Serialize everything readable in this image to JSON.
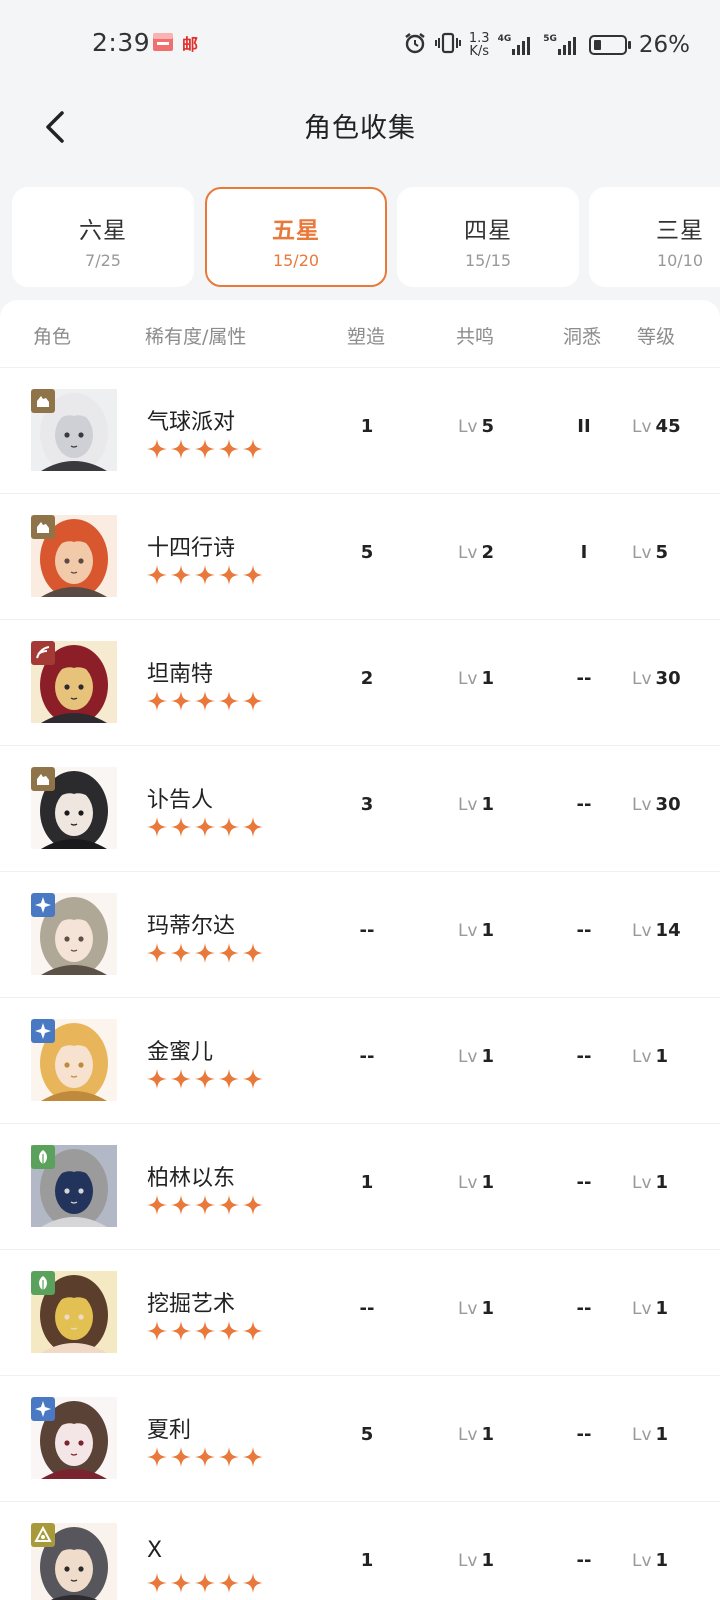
{
  "status_bar": {
    "time": "2:39",
    "app_icon_2": "邮",
    "net_speed_value": "1.3",
    "net_speed_unit": "K/s",
    "net_4g": "4G",
    "net_5g": "5G",
    "battery_percent": "26%",
    "battery_level": 0.26
  },
  "header": {
    "title": "角色收集"
  },
  "tabs": [
    {
      "label": "六星",
      "count": "7/25",
      "active": false
    },
    {
      "label": "五星",
      "count": "15/20",
      "active": true
    },
    {
      "label": "四星",
      "count": "15/15",
      "active": false
    },
    {
      "label": "三星",
      "count": "10/10",
      "active": false
    }
  ],
  "columns": {
    "role": "角色",
    "rarity": "稀有度/属性",
    "mold": "塑造",
    "resonance": "共鸣",
    "insight": "洞悉",
    "level": "等级"
  },
  "level_prefix": "Lv",
  "colors": {
    "accent": "#e8793a",
    "element_beast": "#8e7448",
    "element_spirit": "#4a79c4",
    "element_plant": "#5aa15b",
    "element_star": "#a89a3a",
    "element_mineral": "#a33a35"
  },
  "characters": [
    {
      "name": "气球派对",
      "element": "beast",
      "element_icon": "beast-element-icon",
      "rarity": 5,
      "mold": "1",
      "resonance": "5",
      "insight": "II",
      "level": "45",
      "palette": [
        "#e9e9ec",
        "#cfd0d6",
        "#3a3a3e"
      ]
    },
    {
      "name": "十四行诗",
      "element": "beast",
      "element_icon": "beast-element-icon",
      "rarity": 5,
      "mold": "5",
      "resonance": "2",
      "insight": "I",
      "level": "5",
      "palette": [
        "#d9572e",
        "#f2c9a9",
        "#5a4a44"
      ]
    },
    {
      "name": "坦南特",
      "element": "mineral",
      "element_icon": "mineral-element-icon",
      "rarity": 5,
      "mold": "2",
      "resonance": "1",
      "insight": "--",
      "level": "30",
      "palette": [
        "#8c1e28",
        "#e6c27a",
        "#2f2a30"
      ]
    },
    {
      "name": "讣告人",
      "element": "beast",
      "element_icon": "beast-element-icon",
      "rarity": 5,
      "mold": "3",
      "resonance": "1",
      "insight": "--",
      "level": "30",
      "palette": [
        "#2b2b2e",
        "#efe6df",
        "#1a1a1c"
      ]
    },
    {
      "name": "玛蒂尔达",
      "element": "spirit",
      "element_icon": "spirit-element-icon",
      "rarity": 5,
      "mold": "--",
      "resonance": "1",
      "insight": "--",
      "level": "14",
      "palette": [
        "#b0a896",
        "#f4e3d6",
        "#5b5146"
      ]
    },
    {
      "name": "金蜜儿",
      "element": "spirit",
      "element_icon": "spirit-element-icon",
      "rarity": 5,
      "mold": "--",
      "resonance": "1",
      "insight": "--",
      "level": "1",
      "palette": [
        "#e9b55a",
        "#f6e2cf",
        "#c08a3c"
      ]
    },
    {
      "name": "柏林以东",
      "element": "plant",
      "element_icon": "plant-element-icon",
      "rarity": 5,
      "mold": "1",
      "resonance": "1",
      "insight": "--",
      "level": "1",
      "palette": [
        "#9b9b9c",
        "#22335c",
        "#d6d6d8"
      ]
    },
    {
      "name": "挖掘艺术",
      "element": "plant",
      "element_icon": "plant-element-icon",
      "rarity": 5,
      "mold": "--",
      "resonance": "1",
      "insight": "--",
      "level": "1",
      "palette": [
        "#5b3e2b",
        "#e3c052",
        "#f0d9c6"
      ]
    },
    {
      "name": "夏利",
      "element": "spirit",
      "element_icon": "spirit-element-icon",
      "rarity": 5,
      "mold": "5",
      "resonance": "1",
      "insight": "--",
      "level": "1",
      "palette": [
        "#5a4236",
        "#f4e6e6",
        "#7a2430"
      ]
    },
    {
      "name": "X",
      "element": "star",
      "element_icon": "star-element-icon",
      "rarity": 5,
      "mold": "1",
      "resonance": "1",
      "insight": "--",
      "level": "1",
      "palette": [
        "#56565c",
        "#f0dccb",
        "#2b2b30"
      ]
    }
  ]
}
